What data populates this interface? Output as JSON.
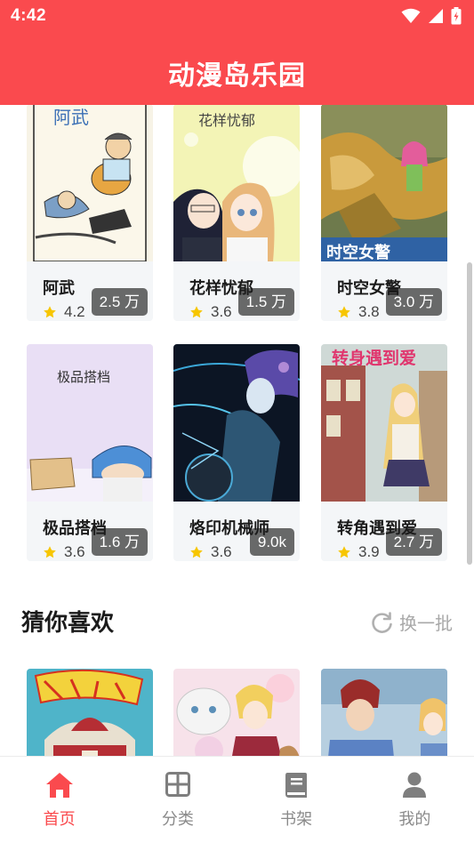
{
  "status_bar": {
    "time": "4:42"
  },
  "app_title": "动漫岛乐园",
  "grid_items": [
    {
      "title": "阿武",
      "count": "2.5 万",
      "rating": "4.2"
    },
    {
      "title": "花样忧郁",
      "count": "1.5 万",
      "rating": "3.6"
    },
    {
      "title": "时空女警",
      "count": "3.0 万",
      "rating": "3.8"
    },
    {
      "title": "极品搭档",
      "count": "1.6 万",
      "rating": "3.6"
    },
    {
      "title": "烙印机械师",
      "count": "9.0k",
      "rating": "3.6"
    },
    {
      "title": "转角遇到爱",
      "count": "2.7 万",
      "rating": "3.9"
    }
  ],
  "cover_texts": {
    "awu": "阿武",
    "huayang": "花样忧郁",
    "jipin": "极品搭档",
    "zhuanjiao": "转身遇到爱"
  },
  "section": {
    "title": "猜你喜欢",
    "refresh_label": "换一批"
  },
  "tabs": [
    {
      "label": "首页",
      "icon": "home-icon",
      "active": true
    },
    {
      "label": "分类",
      "icon": "grid-icon",
      "active": false
    },
    {
      "label": "书架",
      "icon": "book-icon",
      "active": false
    },
    {
      "label": "我的",
      "icon": "user-icon",
      "active": false
    }
  ],
  "colors": {
    "accent": "#fa4a4e",
    "star": "#f7c600"
  }
}
